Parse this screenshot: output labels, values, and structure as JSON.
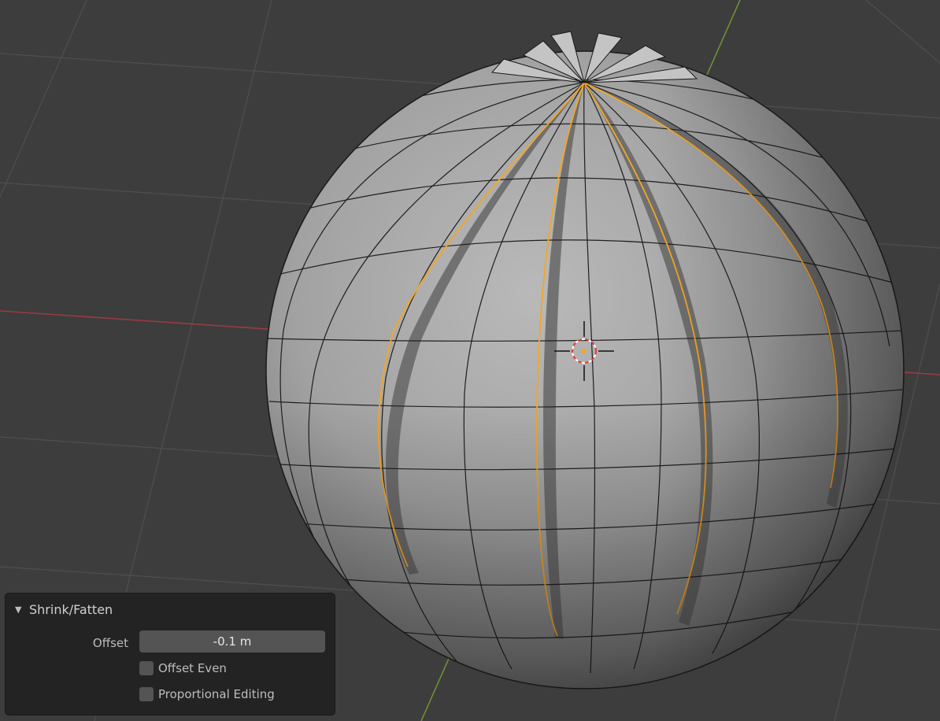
{
  "panel": {
    "title": "Shrink/Fatten",
    "offset_label": "Offset",
    "offset_value": "-0.1 m",
    "offset_even_label": "Offset Even",
    "offset_even_checked": false,
    "proportional_label": "Proportional Editing",
    "proportional_checked": false
  },
  "colors": {
    "background": "#3d3d3d",
    "grid": "#4e4e4e",
    "x_axis": "#9a3b45",
    "y_axis": "#6f8f33",
    "mesh_face": "#a9a9a9",
    "mesh_edge": "#1a1a1a",
    "selected_edge": "#f5a623",
    "panel_bg": "#232323",
    "field_bg": "#545454"
  },
  "icons": {
    "collapse": "disclosure-triangle-down-icon",
    "cursor": "3d-cursor-icon"
  }
}
